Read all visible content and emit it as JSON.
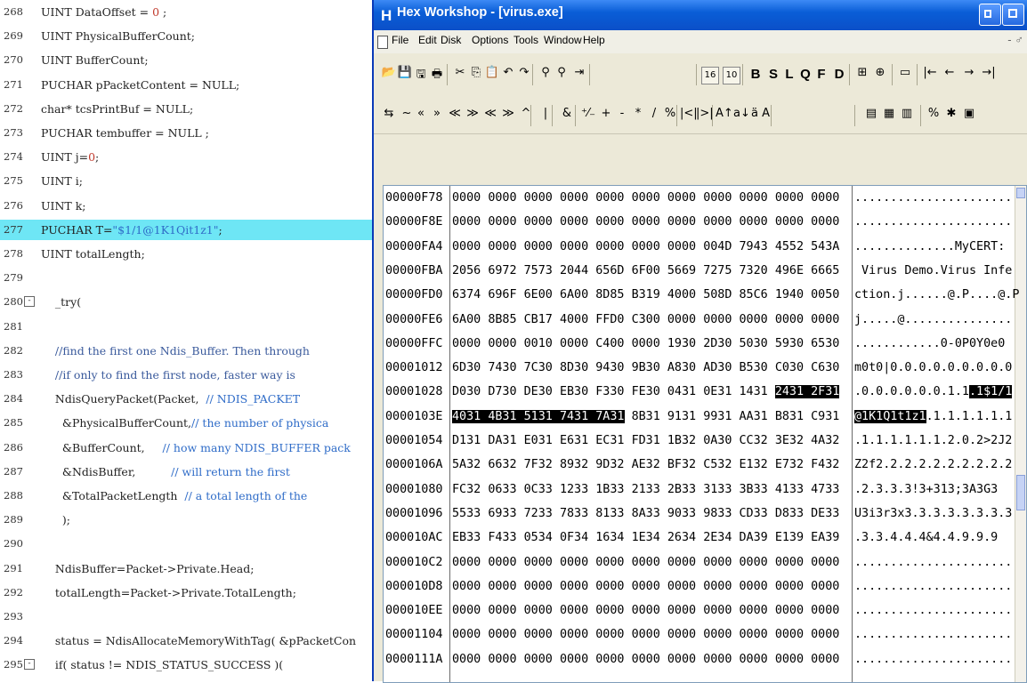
{
  "editor": {
    "lines": [
      {
        "n": "268",
        "segs": [
          {
            "t": "UINT DataOffset = "
          },
          {
            "t": "0",
            "c": "num"
          },
          {
            "t": " ;"
          }
        ]
      },
      {
        "n": "269",
        "segs": [
          {
            "t": "UINT PhysicalBufferCount;"
          }
        ]
      },
      {
        "n": "270",
        "segs": [
          {
            "t": "UINT BufferCount;"
          }
        ]
      },
      {
        "n": "271",
        "segs": [
          {
            "t": "PUCHAR pPacketContent = NULL;"
          }
        ]
      },
      {
        "n": "272",
        "segs": [
          {
            "t": "char* tcsPrintBuf = NULL;"
          }
        ]
      },
      {
        "n": "273",
        "segs": [
          {
            "t": "PUCHAR tembuffer = NULL ;"
          }
        ]
      },
      {
        "n": "274",
        "segs": [
          {
            "t": "UINT j="
          },
          {
            "t": "0",
            "c": "num"
          },
          {
            "t": ";"
          }
        ]
      },
      {
        "n": "275",
        "segs": [
          {
            "t": "UINT i;"
          }
        ]
      },
      {
        "n": "276",
        "segs": [
          {
            "t": "UINT k;"
          }
        ]
      },
      {
        "n": "277",
        "hl": true,
        "segs": [
          {
            "t": "PUCHAR T="
          },
          {
            "t": "\"$1/1@1K1Qit1z1\"",
            "c": "str"
          },
          {
            "t": ";"
          }
        ]
      },
      {
        "n": "278",
        "segs": [
          {
            "t": "UINT totalLength;"
          }
        ]
      },
      {
        "n": "279",
        "segs": []
      },
      {
        "n": "280",
        "fold": "-",
        "segs": [
          {
            "t": "    _try("
          }
        ]
      },
      {
        "n": "281",
        "segs": []
      },
      {
        "n": "282",
        "cls": "cmt",
        "segs": [
          {
            "t": "    //find the first one Ndis_Buffer. Then through"
          }
        ]
      },
      {
        "n": "283",
        "cls": "cmt",
        "segs": [
          {
            "t": "    //if only to find the first node, faster way is"
          }
        ]
      },
      {
        "n": "284",
        "segs": [
          {
            "t": "    NdisQueryPacket(Packet,  "
          },
          {
            "t": "// NDIS_PACKET",
            "c": "str"
          }
        ]
      },
      {
        "n": "285",
        "segs": [
          {
            "t": "      &PhysicalBufferCount,"
          },
          {
            "t": "// the number of physica",
            "c": "str"
          }
        ]
      },
      {
        "n": "286",
        "segs": [
          {
            "t": "      &BufferCount,     "
          },
          {
            "t": "// how many NDIS_BUFFER pack",
            "c": "str"
          }
        ]
      },
      {
        "n": "287",
        "segs": [
          {
            "t": "      &NdisBuffer,          "
          },
          {
            "t": "// will return the first",
            "c": "str"
          }
        ]
      },
      {
        "n": "288",
        "segs": [
          {
            "t": "      &TotalPacketLength  "
          },
          {
            "t": "// a total length of the",
            "c": "str"
          }
        ]
      },
      {
        "n": "289",
        "segs": [
          {
            "t": "      );"
          }
        ]
      },
      {
        "n": "290",
        "segs": []
      },
      {
        "n": "291",
        "segs": [
          {
            "t": "    NdisBuffer=Packet->Private.Head;"
          }
        ]
      },
      {
        "n": "292",
        "segs": [
          {
            "t": "    totalLength=Packet->Private.TotalLength;"
          }
        ]
      },
      {
        "n": "293",
        "segs": []
      },
      {
        "n": "294",
        "segs": [
          {
            "t": "    status = NdisAllocateMemoryWithTag( &pPacketCon"
          }
        ]
      },
      {
        "n": "295",
        "fold": "-",
        "segs": [
          {
            "t": "    if( status != NDIS_STATUS_SUCCESS )("
          }
        ]
      }
    ]
  },
  "hexworkshop": {
    "app_icon": "H",
    "title": "Hex Workshop - [virus.exe]",
    "menu": [
      "File",
      "Edit",
      "Disk",
      "Options",
      "Tools",
      "Window",
      "Help"
    ],
    "mdi_controls": "- ♂",
    "toolbar1": [
      {
        "icon": "open-icon",
        "g": "📂"
      },
      {
        "icon": "save-icon",
        "g": "💾"
      },
      {
        "icon": "save-all-icon",
        "g": "🖫"
      },
      {
        "icon": "print-icon",
        "g": "🖶"
      },
      {
        "icon": "cut-icon",
        "g": "✂"
      },
      {
        "icon": "copy-icon",
        "g": "⎘"
      },
      {
        "icon": "paste-icon",
        "g": "📋"
      },
      {
        "icon": "undo-icon",
        "g": "↶"
      },
      {
        "icon": "redo-icon",
        "g": "↷"
      },
      {
        "icon": "find-icon",
        "g": "⚲"
      },
      {
        "icon": "find-next-icon",
        "g": "⚲"
      },
      {
        "icon": "goto-icon",
        "g": "⇥"
      },
      {
        "icon": "base16-icon",
        "g": "16"
      },
      {
        "icon": "base10-icon",
        "g": "10"
      },
      {
        "icon": "byte-mode",
        "g": "B"
      },
      {
        "icon": "short-mode",
        "g": "S"
      },
      {
        "icon": "long-mode",
        "g": "L"
      },
      {
        "icon": "quad-mode",
        "g": "Q"
      },
      {
        "icon": "float-mode",
        "g": "F"
      },
      {
        "icon": "double-mode",
        "g": "D"
      },
      {
        "icon": "bookmark-icon",
        "g": "⊞"
      },
      {
        "icon": "bookmark-add-icon",
        "g": "⊕"
      },
      {
        "icon": "view-icon",
        "g": "▭"
      },
      {
        "icon": "first-icon",
        "g": "|←"
      },
      {
        "icon": "prev-icon",
        "g": "←"
      },
      {
        "icon": "next-icon",
        "g": "→"
      },
      {
        "icon": "last-icon",
        "g": "→|"
      }
    ],
    "toolbar2": [
      {
        "icon": "operations-icon",
        "g": "⇆"
      },
      {
        "icon": "not-icon",
        "g": "~"
      },
      {
        "icon": "shift-left-icon",
        "g": "«"
      },
      {
        "icon": "shift-right-icon",
        "g": "»"
      },
      {
        "icon": "rotate-left-icon",
        "g": "≪"
      },
      {
        "icon": "rotate-right-icon",
        "g": "≫"
      },
      {
        "icon": "block-left-icon",
        "g": "≪"
      },
      {
        "icon": "block-right-icon",
        "g": "≫"
      },
      {
        "icon": "xor-icon",
        "g": "^"
      },
      {
        "icon": "or-icon",
        "g": "|"
      },
      {
        "icon": "and-icon",
        "g": "&"
      },
      {
        "icon": "negate-icon",
        "g": "⁺⁄₋"
      },
      {
        "icon": "add-icon",
        "g": "+"
      },
      {
        "icon": "subtract-icon",
        "g": "-"
      },
      {
        "icon": "multiply-icon",
        "g": "*"
      },
      {
        "icon": "divide-icon",
        "g": "/"
      },
      {
        "icon": "mod-icon",
        "g": "%"
      },
      {
        "icon": "swap-left-icon",
        "g": "|<|"
      },
      {
        "icon": "swap-right-icon",
        "g": "|>|"
      },
      {
        "icon": "uppercase-icon",
        "g": "A↑"
      },
      {
        "icon": "lowercase-icon",
        "g": "a↓"
      },
      {
        "icon": "invert-case-icon",
        "g": "ä A"
      },
      {
        "icon": "compare-icon",
        "g": "▤"
      },
      {
        "icon": "checksum-icon",
        "g": "▦"
      },
      {
        "icon": "structure-icon",
        "g": "▥"
      },
      {
        "icon": "percent-tool-icon",
        "g": "%"
      },
      {
        "icon": "gear-icon",
        "g": "✱"
      },
      {
        "icon": "calculator-icon",
        "g": "▣"
      }
    ],
    "rows": [
      {
        "addr": "00000F78",
        "bytes": [
          "0000",
          "0000",
          "0000",
          "0000",
          "0000",
          "0000",
          "0000",
          "0000",
          "0000",
          "0000",
          "0000"
        ],
        "ascii": "......................"
      },
      {
        "addr": "00000F8E",
        "bytes": [
          "0000",
          "0000",
          "0000",
          "0000",
          "0000",
          "0000",
          "0000",
          "0000",
          "0000",
          "0000",
          "0000"
        ],
        "ascii": "......................"
      },
      {
        "addr": "00000FA4",
        "bytes": [
          "0000",
          "0000",
          "0000",
          "0000",
          "0000",
          "0000",
          "0000",
          "004D",
          "7943",
          "4552",
          "543A"
        ],
        "ascii": "..............MyCERT:"
      },
      {
        "addr": "00000FBA",
        "bytes": [
          "2056",
          "6972",
          "7573",
          "2044",
          "656D",
          "6F00",
          "5669",
          "7275",
          "7320",
          "496E",
          "6665"
        ],
        "ascii": " Virus Demo.Virus Infe"
      },
      {
        "addr": "00000FD0",
        "bytes": [
          "6374",
          "696F",
          "6E00",
          "6A00",
          "8D85",
          "B319",
          "4000",
          "508D",
          "85C6",
          "1940",
          "0050"
        ],
        "ascii": "ction.j......@.P....@.P"
      },
      {
        "addr": "00000FE6",
        "bytes": [
          "6A00",
          "8B85",
          "CB17",
          "4000",
          "FFD0",
          "C300",
          "0000",
          "0000",
          "0000",
          "0000",
          "0000"
        ],
        "ascii": "j.....@..............."
      },
      {
        "addr": "00000FFC",
        "bytes": [
          "0000",
          "0000",
          "0010",
          "0000",
          "C400",
          "0000",
          "1930",
          "2D30",
          "5030",
          "5930",
          "6530"
        ],
        "ascii": "............0-0P0Y0e0"
      },
      {
        "addr": "00001012",
        "bytes": [
          "6D30",
          "7430",
          "7C30",
          "8D30",
          "9430",
          "9B30",
          "A830",
          "AD30",
          "B530",
          "C030",
          "C630"
        ],
        "ascii": "m0t0|0.0.0.0.0.0.0.0.0"
      },
      {
        "addr": "00001028",
        "bytes": [
          "D030",
          "D730",
          "DE30",
          "EB30",
          "F330",
          "FE30",
          "0431",
          "0E31",
          "1431",
          "2431",
          "2F31"
        ],
        "ascii": ".0.0.0.0.0.0.1.1.1$1/1",
        "selFrom": 9,
        "selTo": 10,
        "asciiSelStart": 16
      },
      {
        "addr": "0000103E",
        "bytes": [
          "4031",
          "4B31",
          "5131",
          "7431",
          "7A31",
          "8B31",
          "9131",
          "9931",
          "AA31",
          "B831",
          "C931"
        ],
        "ascii": "@1K1Q1t1z1.1.1.1.1.1.1",
        "selFrom": 0,
        "selTo": 4,
        "asciiSelEnd": 10
      },
      {
        "addr": "00001054",
        "bytes": [
          "D131",
          "DA31",
          "E031",
          "E631",
          "EC31",
          "FD31",
          "1B32",
          "0A30",
          "CC32",
          "3E32",
          "4A32"
        ],
        "ascii": ".1.1.1.1.1.1.2.0.2>2J2"
      },
      {
        "addr": "0000106A",
        "bytes": [
          "5A32",
          "6632",
          "7F32",
          "8932",
          "9D32",
          "AE32",
          "BF32",
          "C532",
          "E132",
          "E732",
          "F432"
        ],
        "ascii": "Z2f2.2.2.2.2.2.2.2.2.2"
      },
      {
        "addr": "00001080",
        "bytes": [
          "FC32",
          "0633",
          "0C33",
          "1233",
          "1B33",
          "2133",
          "2B33",
          "3133",
          "3B33",
          "4133",
          "4733"
        ],
        "ascii": ".2.3.3.3!3+313;3A3G3"
      },
      {
        "addr": "00001096",
        "bytes": [
          "5533",
          "6933",
          "7233",
          "7833",
          "8133",
          "8A33",
          "9033",
          "9833",
          "CD33",
          "D833",
          "DE33"
        ],
        "ascii": "U3i3r3x3.3.3.3.3.3.3.3"
      },
      {
        "addr": "000010AC",
        "bytes": [
          "EB33",
          "F433",
          "0534",
          "0F34",
          "1634",
          "1E34",
          "2634",
          "2E34",
          "DA39",
          "E139",
          "EA39"
        ],
        "ascii": ".3.3.4.4.4&4.4.9.9.9"
      },
      {
        "addr": "000010C2",
        "bytes": [
          "0000",
          "0000",
          "0000",
          "0000",
          "0000",
          "0000",
          "0000",
          "0000",
          "0000",
          "0000",
          "0000"
        ],
        "ascii": "......................"
      },
      {
        "addr": "000010D8",
        "bytes": [
          "0000",
          "0000",
          "0000",
          "0000",
          "0000",
          "0000",
          "0000",
          "0000",
          "0000",
          "0000",
          "0000"
        ],
        "ascii": "......................"
      },
      {
        "addr": "000010EE",
        "bytes": [
          "0000",
          "0000",
          "0000",
          "0000",
          "0000",
          "0000",
          "0000",
          "0000",
          "0000",
          "0000",
          "0000"
        ],
        "ascii": "......................"
      },
      {
        "addr": "00001104",
        "bytes": [
          "0000",
          "0000",
          "0000",
          "0000",
          "0000",
          "0000",
          "0000",
          "0000",
          "0000",
          "0000",
          "0000"
        ],
        "ascii": "......................"
      },
      {
        "addr": "0000111A",
        "bytes": [
          "0000",
          "0000",
          "0000",
          "0000",
          "0000",
          "0000",
          "0000",
          "0000",
          "0000",
          "0000",
          "0000"
        ],
        "ascii": "......................"
      }
    ]
  },
  "colors": {
    "highlight_line": "#6ee6f5",
    "title_bar": "#0a5ed7",
    "selection": "#000000"
  }
}
